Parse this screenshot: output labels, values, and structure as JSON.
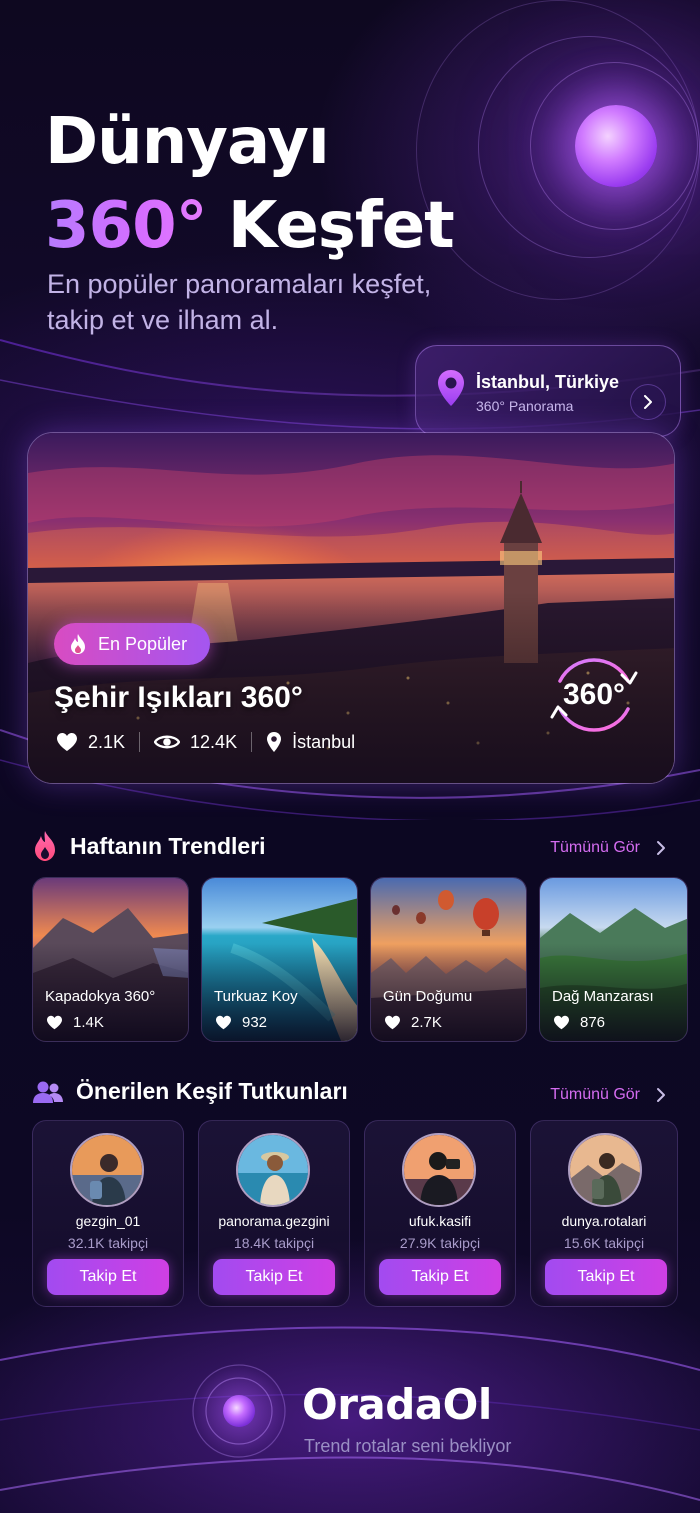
{
  "hero": {
    "title_line1": "Dünyayı",
    "title_accent": "360°",
    "title_rest": " Keşfet",
    "subtitle": "En popüler panoramaları keşfet, takip et ve ilham al."
  },
  "location_chip": {
    "title": "İstanbul, Türkiye",
    "subtitle": "360° Panorama"
  },
  "featured": {
    "badge": "En Popüler",
    "title": "Şehir Işıkları 360°",
    "likes": "2.1K",
    "views": "12.4K",
    "place": "İstanbul",
    "badge_360": "360°"
  },
  "trends": {
    "title": "Haftanın Trendleri",
    "see_all": "Tümünü Gör",
    "items": [
      {
        "name": "Kapadokya 360°",
        "likes": "1.4K"
      },
      {
        "name": "Turkuaz Koy",
        "likes": "932"
      },
      {
        "name": "Gün Doğumu",
        "likes": "2.7K"
      },
      {
        "name": "Dağ Manzarası",
        "likes": "876"
      }
    ]
  },
  "users": {
    "title": "Önerilen Keşif Tutkunları",
    "see_all": "Tümünü Gör",
    "follow_label": "Takip Et",
    "items": [
      {
        "username": "gezgin_01",
        "followers": "32.1K takipçi"
      },
      {
        "username": "panorama.gezgini",
        "followers": "18.4K takipçi"
      },
      {
        "username": "ufuk.kasifi",
        "followers": "27.9K takipçi"
      },
      {
        "username": "dunya.rotalari",
        "followers": "15.6K takipçi"
      }
    ]
  },
  "footer": {
    "brand": "OradaOl",
    "tagline": "Trend rotalar seni bekliyor"
  },
  "colors": {
    "accent": "#c45cf2",
    "button": "#b145ea",
    "background": "#110a27"
  }
}
